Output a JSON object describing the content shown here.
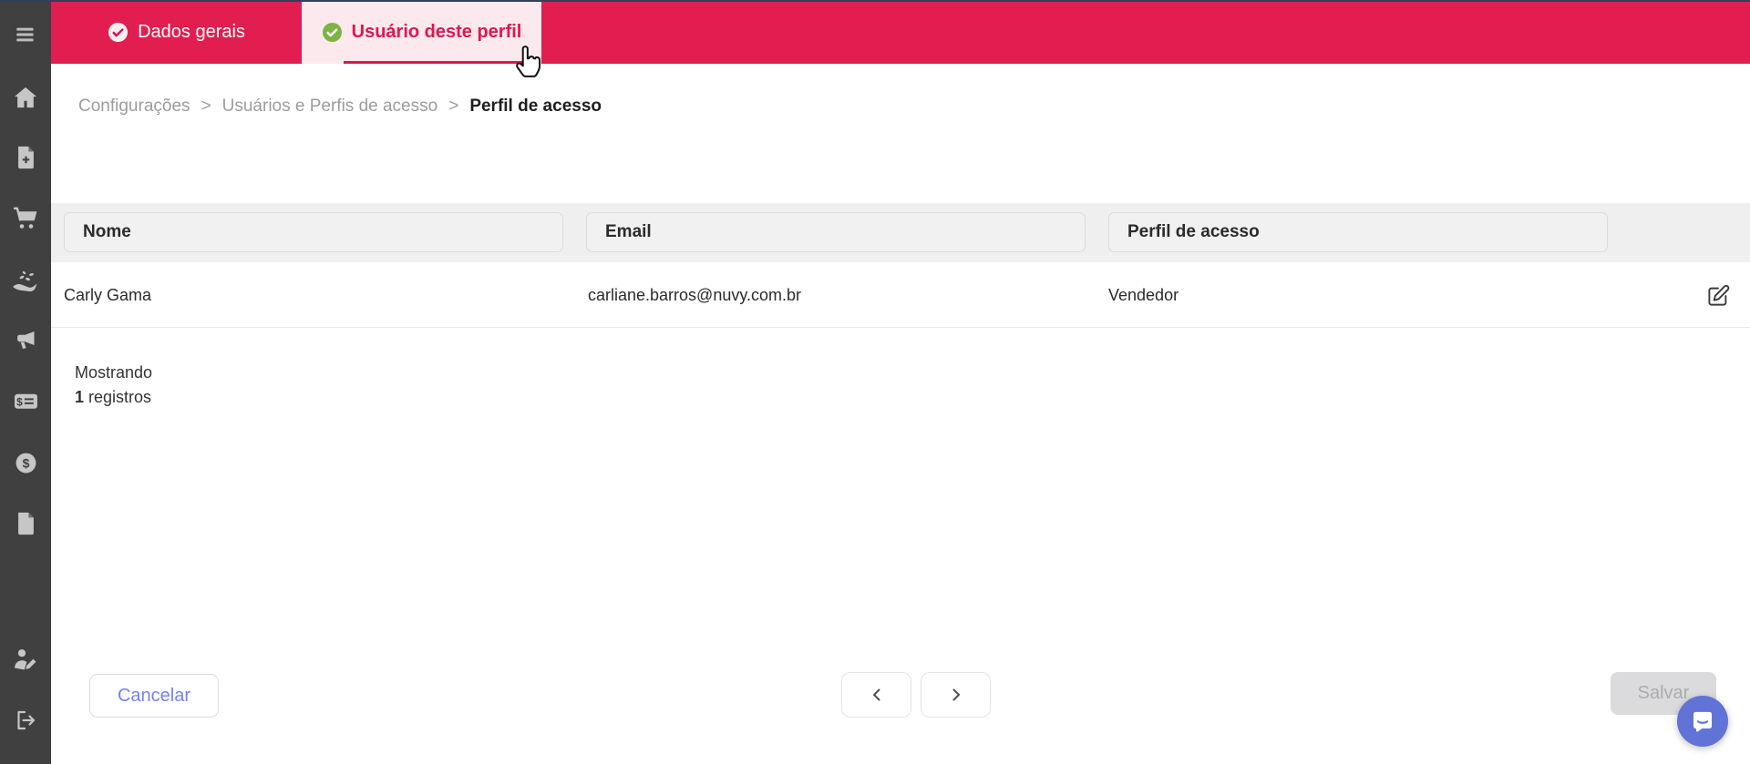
{
  "topbar": {
    "tabs": [
      {
        "label": "Dados gerais",
        "status": "completed"
      },
      {
        "label": "Usuário deste perfil",
        "status": "active"
      }
    ]
  },
  "breadcrumb": {
    "separator": ">",
    "items": [
      {
        "label": "Configurações"
      },
      {
        "label": "Usuários e Perfis de acesso"
      },
      {
        "label": "Perfil de acesso"
      }
    ]
  },
  "filters": {
    "nome": {
      "placeholder": "Nome",
      "value": ""
    },
    "email": {
      "placeholder": "Email",
      "value": ""
    },
    "perfil": {
      "placeholder": "Perfil de acesso",
      "value": ""
    }
  },
  "table": {
    "rows": [
      {
        "nome": "Carly Gama",
        "email": "carliane.barros@nuvy.com.br",
        "perfil": "Vendedor"
      }
    ]
  },
  "summary": {
    "showing_label": "Mostrando",
    "count": "1",
    "unit_label": "registros"
  },
  "footer": {
    "cancel_label": "Cancelar",
    "save_label": "Salvar"
  },
  "colors": {
    "topbar": "#E11E4F",
    "active_tab_bg": "#FBE9EE",
    "tab_indicator": "#DE1650",
    "check_green": "#7CB342",
    "sidebar": "#404040",
    "accent_indigo": "#7482F0",
    "chat_fab": "#6173D6",
    "filter_band": "#EFEFEF"
  },
  "icons": {
    "sidebar": [
      "menu-icon",
      "home-icon",
      "file-plus-icon",
      "cart-icon",
      "hand-coins-icon",
      "megaphone-icon",
      "billing-icon",
      "dollar-circle-icon",
      "document-icon",
      "user-edit-icon",
      "logout-icon"
    ],
    "tab_completed": "check-circle-icon",
    "row_action": "pencil-square-icon",
    "pagination": [
      "chevron-left-icon",
      "chevron-right-icon"
    ],
    "chat": "messenger-icon",
    "pointer": "hand-pointer-cursor"
  }
}
